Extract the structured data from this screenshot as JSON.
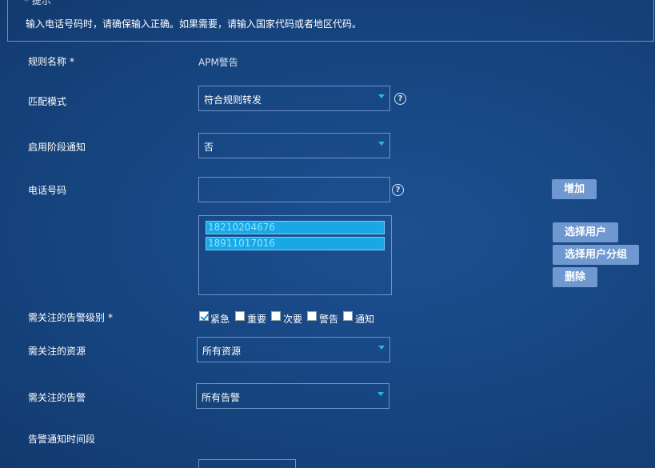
{
  "tip": {
    "title": "* 提示",
    "text": "输入电话号码时，请确保输入正确。如果需要，请输入国家代码或者地区代码。"
  },
  "form": {
    "rule_name_label": "规则名称",
    "required_mark": "*",
    "rule_name_value": "APM警告",
    "match_mode_label": "匹配模式",
    "match_mode_value": "符合规则转发",
    "stage_notify_label": "启用阶段通知",
    "stage_notify_value": "否",
    "phone_label": "电话号码",
    "phone_value": "",
    "phone_list": [
      "18210204676",
      "18911017016"
    ],
    "severity_label": "需关注的告警级别",
    "severity_options": [
      {
        "label": "紧急",
        "checked": true
      },
      {
        "label": "重要",
        "checked": false
      },
      {
        "label": "次要",
        "checked": false
      },
      {
        "label": "警告",
        "checked": false
      },
      {
        "label": "通知",
        "checked": false
      }
    ],
    "resource_label": "需关注的资源",
    "resource_value": "所有资源",
    "alarm_label": "需关注的告警",
    "alarm_value": "所有告警",
    "time_label": "告警通知时间段"
  },
  "buttons": {
    "add": "增加",
    "select_user": "选择用户",
    "select_group": "选择用户分组",
    "delete": "删除"
  },
  "help_symbol": "?",
  "colors": {
    "background": "#16457f",
    "border": "#6f92c6",
    "button": "#6e98cf",
    "selected_item": "#1aa7e6",
    "caret": "#25b6e8"
  }
}
